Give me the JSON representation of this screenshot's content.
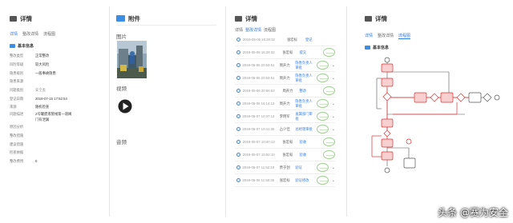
{
  "col1": {
    "title": "详情",
    "tabs": [
      "详情",
      "整改详情",
      "流程图"
    ],
    "section": "基本信息",
    "fields": [
      {
        "k": "整改类型",
        "v": "正常整改"
      },
      {
        "k": "风险等级",
        "v": "较大风险"
      },
      {
        "k": "隐患级别",
        "v": "一般事故隐患"
      },
      {
        "k": "隐患来源",
        "v": ""
      },
      {
        "k": "问题类别",
        "v": "安全类"
      },
      {
        "k": "登记日期",
        "v": "2019-07-15 17:52:54"
      },
      {
        "k": "来源",
        "v": "随机检查"
      },
      {
        "k": "问题描述",
        "v": "2号罐废液管线第一道阀"
      },
      {
        "k": "",
        "v": "门有泄漏"
      },
      {
        "k": "原因分析",
        "v": ""
      },
      {
        "k": "整改措施",
        "v": ""
      },
      {
        "k": "建议措施",
        "v": ""
      },
      {
        "k": "检查依据",
        "v": ""
      },
      {
        "k": "整改费用",
        "v": "0"
      }
    ]
  },
  "col2": {
    "title": "附件",
    "picture_label": "图片",
    "video_label": "视频",
    "audio_label": "音频"
  },
  "col3": {
    "title": "详情",
    "tabs": [
      "详情",
      "整改详情",
      "流程图"
    ],
    "rows": [
      {
        "time": "2019-05-06 15:28:32",
        "who": "张宏标",
        "action": "登记"
      },
      {
        "time": "2019-05-06 15:28:32",
        "who": "张宏标",
        "action": "提交"
      },
      {
        "time": "2019-05-06 20:53:51",
        "who": "周开力",
        "action": "隐患负责人审批"
      },
      {
        "time": "2019-05-06 20:53:51",
        "who": "周开力",
        "action": "隐患负责人审批"
      },
      {
        "time": "2019-05-06 20:56:53",
        "who": "周开力",
        "action": "整改"
      },
      {
        "time": "2019-05-06 16:14:13",
        "who": "周开力",
        "action": "隐患负责人审批"
      },
      {
        "time": "2019-05-07 10:37:13",
        "who": "李明军",
        "action": "直属部门审批"
      },
      {
        "time": "2019-05-07 10:41:36",
        "who": "占少佳",
        "action": "总经理审批"
      },
      {
        "time": "2019-05-07 10:40:13",
        "who": "张宏标",
        "action": "验收"
      },
      {
        "time": "2019-05-07 10:52:10",
        "who": "张宏标",
        "action": "验收"
      },
      {
        "time": "2019-05-07 11:52:33",
        "who": "贾于创",
        "action": "验证"
      },
      {
        "time": "2019-05-06 11:50:35",
        "who": "张宏标",
        "action": "验证修改"
      }
    ]
  },
  "col4": {
    "title": "详情",
    "tabs": [
      "详情",
      "整改详情",
      "流程图"
    ],
    "section": "基本信息"
  },
  "watermark": "头条 @赛为安全",
  "colors": {
    "accent": "#2d7be5",
    "flow_red": "#e03131",
    "flow_fill": "#f8d0d0"
  }
}
